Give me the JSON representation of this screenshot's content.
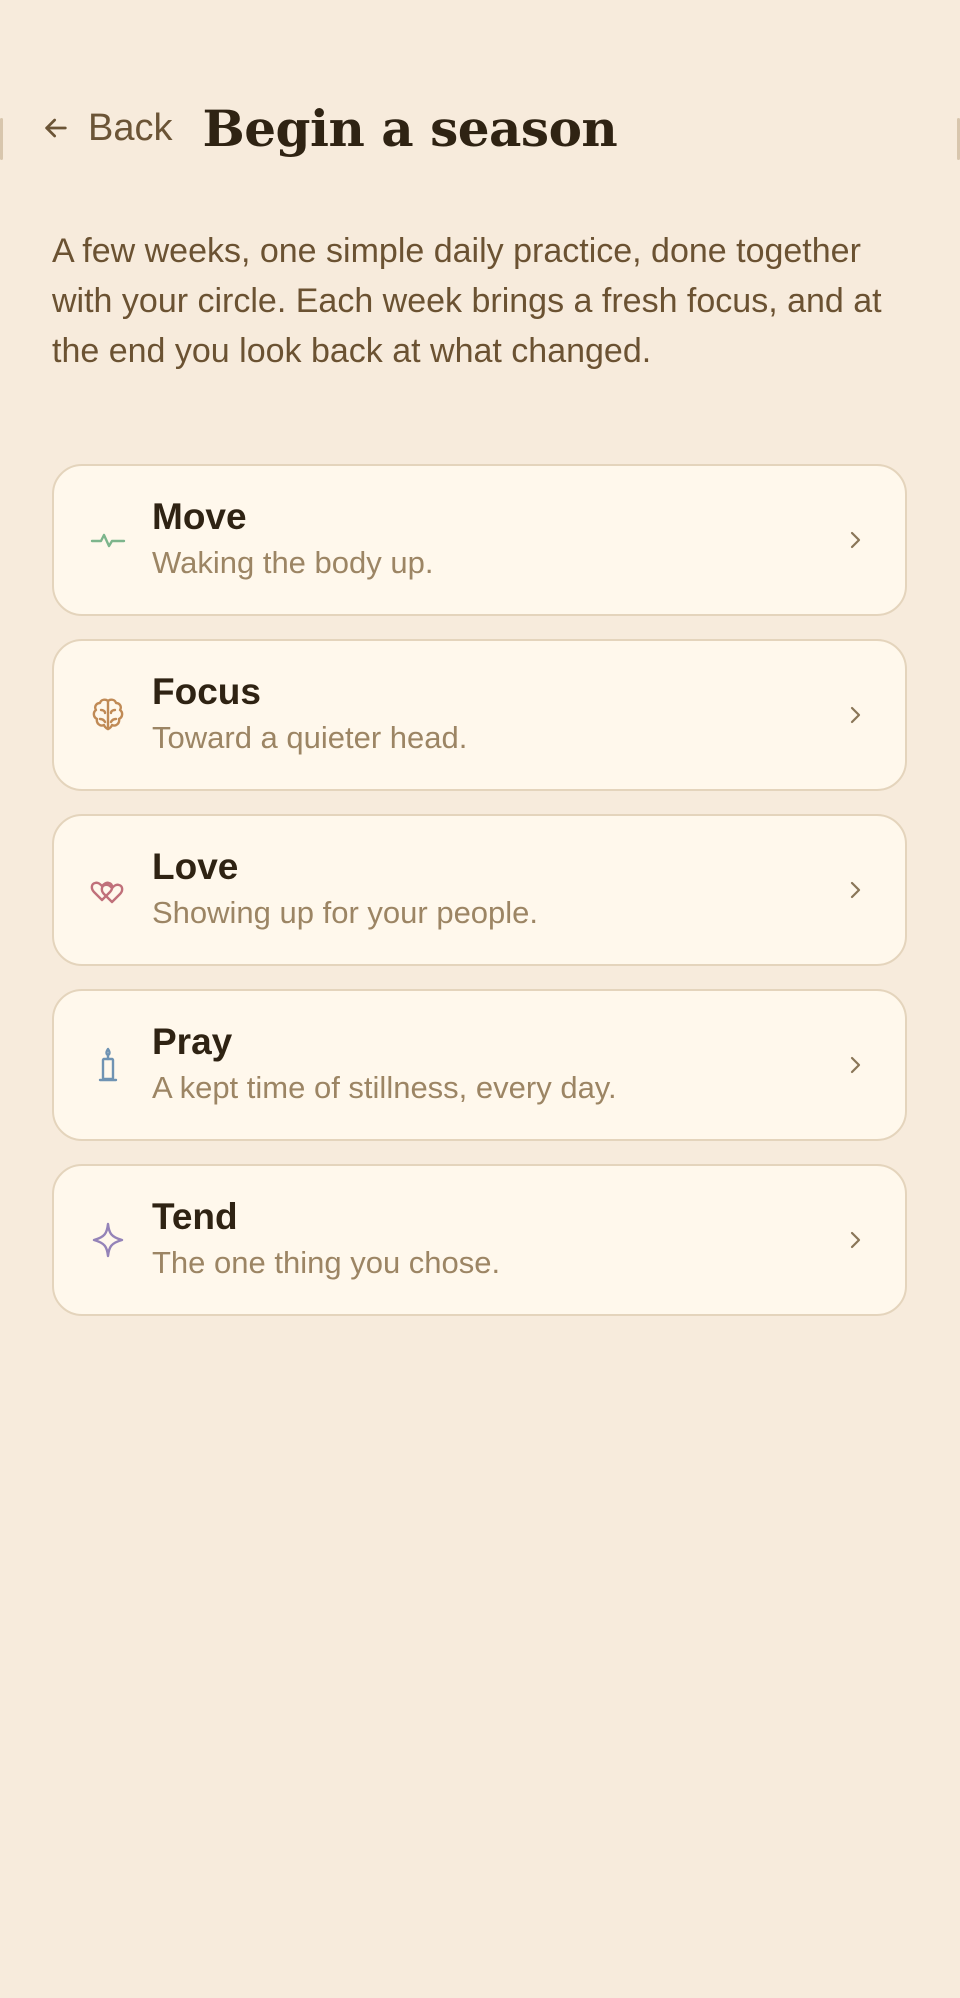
{
  "header": {
    "back_label": "Back",
    "title": "Begin a season"
  },
  "intro": "A few weeks, one simple daily practice, done together with your circle. Each week brings a fresh focus, and at the end you look back at what changed.",
  "seasons": [
    {
      "name": "Move",
      "description": "Waking the body up.",
      "icon": "pulse-icon",
      "color": "#7db58c"
    },
    {
      "name": "Focus",
      "description": "Toward a quieter head.",
      "icon": "brain-icon",
      "color": "#c08a55"
    },
    {
      "name": "Love",
      "description": "Showing up for your people.",
      "icon": "hearts-icon",
      "color": "#c0707a"
    },
    {
      "name": "Pray",
      "description": "A kept time of stillness, every day.",
      "icon": "candle-icon",
      "color": "#6f93b3"
    },
    {
      "name": "Tend",
      "description": "The one thing you chose.",
      "icon": "sparkle-icon",
      "color": "#9483b8"
    }
  ]
}
